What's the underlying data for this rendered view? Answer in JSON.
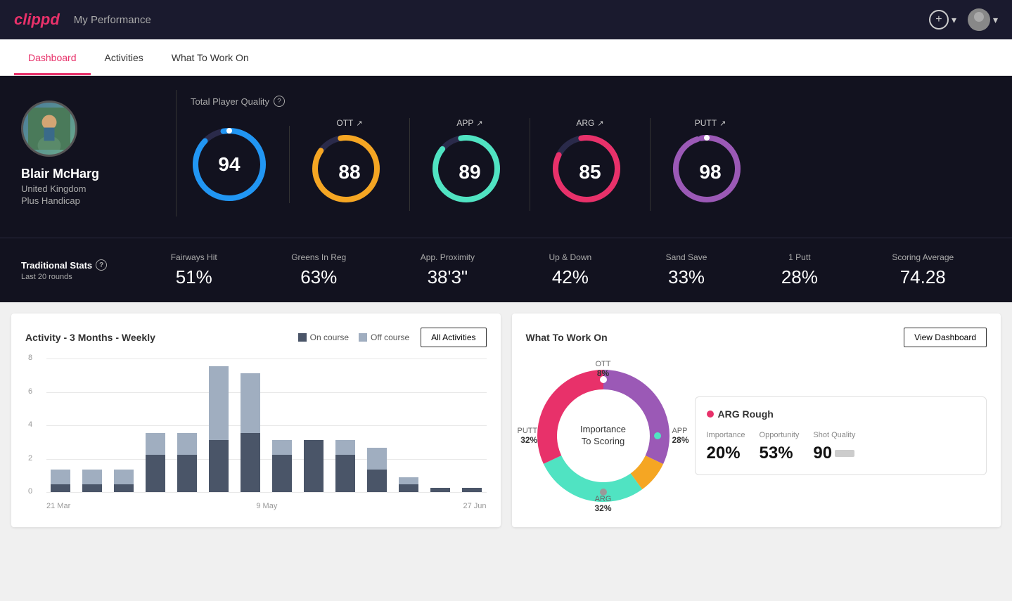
{
  "header": {
    "logo": "clippd",
    "title": "My Performance",
    "plus_label": "+",
    "chevron_down": "▾"
  },
  "nav": {
    "tabs": [
      {
        "label": "Dashboard",
        "active": true
      },
      {
        "label": "Activities",
        "active": false
      },
      {
        "label": "What To Work On",
        "active": false
      }
    ]
  },
  "player": {
    "name": "Blair McHarg",
    "country": "United Kingdom",
    "handicap": "Plus Handicap"
  },
  "quality": {
    "title": "Total Player Quality",
    "scores": [
      {
        "label": "OTT",
        "value": "88",
        "color_start": "#f5a623",
        "color_end": "#f5a623",
        "pct": 88
      },
      {
        "label": "APP",
        "value": "89",
        "color_start": "#50e3c2",
        "color_end": "#50e3c2",
        "pct": 89
      },
      {
        "label": "ARG",
        "value": "85",
        "color_start": "#e8316a",
        "color_end": "#e8316a",
        "pct": 85
      },
      {
        "label": "PUTT",
        "value": "98",
        "color_start": "#9b59b6",
        "color_end": "#9b59b6",
        "pct": 98
      }
    ],
    "main_value": "94",
    "main_color_start": "#2196f3",
    "main_color_end": "#2196f3",
    "main_pct": 94
  },
  "traditional_stats": {
    "title": "Traditional Stats",
    "subtitle": "Last 20 rounds",
    "items": [
      {
        "label": "Fairways Hit",
        "value": "51%"
      },
      {
        "label": "Greens In Reg",
        "value": "63%"
      },
      {
        "label": "App. Proximity",
        "value": "38'3\""
      },
      {
        "label": "Up & Down",
        "value": "42%"
      },
      {
        "label": "Sand Save",
        "value": "33%"
      },
      {
        "label": "1 Putt",
        "value": "28%"
      },
      {
        "label": "Scoring Average",
        "value": "74.28"
      }
    ]
  },
  "activity_chart": {
    "title": "Activity - 3 Months - Weekly",
    "legend_on_course": "On course",
    "legend_off_course": "Off course",
    "all_activities_btn": "All Activities",
    "y_labels": [
      "8",
      "6",
      "4",
      "2",
      "0"
    ],
    "x_labels": [
      "21 Mar",
      "9 May",
      "27 Jun"
    ],
    "bars": [
      {
        "on": 0.5,
        "off": 1.0
      },
      {
        "on": 0.5,
        "off": 1.0
      },
      {
        "on": 0.5,
        "off": 1.0
      },
      {
        "on": 2.5,
        "off": 1.5
      },
      {
        "on": 2.5,
        "off": 1.5
      },
      {
        "on": 3.5,
        "off": 5.0
      },
      {
        "on": 4.0,
        "off": 4.0
      },
      {
        "on": 2.5,
        "off": 1.0
      },
      {
        "on": 3.5,
        "off": 0.0
      },
      {
        "on": 2.5,
        "off": 1.0
      },
      {
        "on": 1.5,
        "off": 1.5
      },
      {
        "on": 0.5,
        "off": 0.5
      },
      {
        "on": 0.3,
        "off": 0.0
      },
      {
        "on": 0.3,
        "off": 0.0
      }
    ],
    "max_val": 9
  },
  "workon": {
    "title": "What To Work On",
    "view_dashboard_btn": "View Dashboard",
    "donut_center_line1": "Importance",
    "donut_center_line2": "To Scoring",
    "segments": [
      {
        "label": "OTT",
        "pct": 8,
        "color": "#f5a623"
      },
      {
        "label": "APP",
        "pct": 28,
        "color": "#50e3c2"
      },
      {
        "label": "ARG",
        "pct": 32,
        "color": "#e8316a"
      },
      {
        "label": "PUTT",
        "pct": 32,
        "color": "#9b59b6"
      }
    ],
    "arg_card": {
      "title": "ARG Rough",
      "importance_label": "Importance",
      "importance_value": "20%",
      "opportunity_label": "Opportunity",
      "opportunity_value": "53%",
      "shot_quality_label": "Shot Quality",
      "shot_quality_value": "90"
    }
  }
}
